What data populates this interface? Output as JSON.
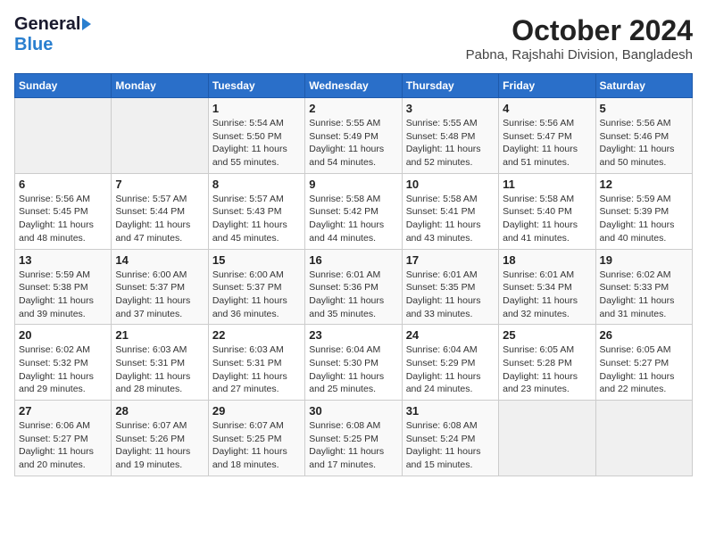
{
  "header": {
    "logo": {
      "general": "General",
      "blue": "Blue"
    },
    "title": "October 2024",
    "location": "Pabna, Rajshahi Division, Bangladesh"
  },
  "calendar": {
    "days_of_week": [
      "Sunday",
      "Monday",
      "Tuesday",
      "Wednesday",
      "Thursday",
      "Friday",
      "Saturday"
    ],
    "weeks": [
      [
        {
          "day": "",
          "info": ""
        },
        {
          "day": "",
          "info": ""
        },
        {
          "day": "1",
          "info": "Sunrise: 5:54 AM\nSunset: 5:50 PM\nDaylight: 11 hours and 55 minutes."
        },
        {
          "day": "2",
          "info": "Sunrise: 5:55 AM\nSunset: 5:49 PM\nDaylight: 11 hours and 54 minutes."
        },
        {
          "day": "3",
          "info": "Sunrise: 5:55 AM\nSunset: 5:48 PM\nDaylight: 11 hours and 52 minutes."
        },
        {
          "day": "4",
          "info": "Sunrise: 5:56 AM\nSunset: 5:47 PM\nDaylight: 11 hours and 51 minutes."
        },
        {
          "day": "5",
          "info": "Sunrise: 5:56 AM\nSunset: 5:46 PM\nDaylight: 11 hours and 50 minutes."
        }
      ],
      [
        {
          "day": "6",
          "info": "Sunrise: 5:56 AM\nSunset: 5:45 PM\nDaylight: 11 hours and 48 minutes."
        },
        {
          "day": "7",
          "info": "Sunrise: 5:57 AM\nSunset: 5:44 PM\nDaylight: 11 hours and 47 minutes."
        },
        {
          "day": "8",
          "info": "Sunrise: 5:57 AM\nSunset: 5:43 PM\nDaylight: 11 hours and 45 minutes."
        },
        {
          "day": "9",
          "info": "Sunrise: 5:58 AM\nSunset: 5:42 PM\nDaylight: 11 hours and 44 minutes."
        },
        {
          "day": "10",
          "info": "Sunrise: 5:58 AM\nSunset: 5:41 PM\nDaylight: 11 hours and 43 minutes."
        },
        {
          "day": "11",
          "info": "Sunrise: 5:58 AM\nSunset: 5:40 PM\nDaylight: 11 hours and 41 minutes."
        },
        {
          "day": "12",
          "info": "Sunrise: 5:59 AM\nSunset: 5:39 PM\nDaylight: 11 hours and 40 minutes."
        }
      ],
      [
        {
          "day": "13",
          "info": "Sunrise: 5:59 AM\nSunset: 5:38 PM\nDaylight: 11 hours and 39 minutes."
        },
        {
          "day": "14",
          "info": "Sunrise: 6:00 AM\nSunset: 5:37 PM\nDaylight: 11 hours and 37 minutes."
        },
        {
          "day": "15",
          "info": "Sunrise: 6:00 AM\nSunset: 5:37 PM\nDaylight: 11 hours and 36 minutes."
        },
        {
          "day": "16",
          "info": "Sunrise: 6:01 AM\nSunset: 5:36 PM\nDaylight: 11 hours and 35 minutes."
        },
        {
          "day": "17",
          "info": "Sunrise: 6:01 AM\nSunset: 5:35 PM\nDaylight: 11 hours and 33 minutes."
        },
        {
          "day": "18",
          "info": "Sunrise: 6:01 AM\nSunset: 5:34 PM\nDaylight: 11 hours and 32 minutes."
        },
        {
          "day": "19",
          "info": "Sunrise: 6:02 AM\nSunset: 5:33 PM\nDaylight: 11 hours and 31 minutes."
        }
      ],
      [
        {
          "day": "20",
          "info": "Sunrise: 6:02 AM\nSunset: 5:32 PM\nDaylight: 11 hours and 29 minutes."
        },
        {
          "day": "21",
          "info": "Sunrise: 6:03 AM\nSunset: 5:31 PM\nDaylight: 11 hours and 28 minutes."
        },
        {
          "day": "22",
          "info": "Sunrise: 6:03 AM\nSunset: 5:31 PM\nDaylight: 11 hours and 27 minutes."
        },
        {
          "day": "23",
          "info": "Sunrise: 6:04 AM\nSunset: 5:30 PM\nDaylight: 11 hours and 25 minutes."
        },
        {
          "day": "24",
          "info": "Sunrise: 6:04 AM\nSunset: 5:29 PM\nDaylight: 11 hours and 24 minutes."
        },
        {
          "day": "25",
          "info": "Sunrise: 6:05 AM\nSunset: 5:28 PM\nDaylight: 11 hours and 23 minutes."
        },
        {
          "day": "26",
          "info": "Sunrise: 6:05 AM\nSunset: 5:27 PM\nDaylight: 11 hours and 22 minutes."
        }
      ],
      [
        {
          "day": "27",
          "info": "Sunrise: 6:06 AM\nSunset: 5:27 PM\nDaylight: 11 hours and 20 minutes."
        },
        {
          "day": "28",
          "info": "Sunrise: 6:07 AM\nSunset: 5:26 PM\nDaylight: 11 hours and 19 minutes."
        },
        {
          "day": "29",
          "info": "Sunrise: 6:07 AM\nSunset: 5:25 PM\nDaylight: 11 hours and 18 minutes."
        },
        {
          "day": "30",
          "info": "Sunrise: 6:08 AM\nSunset: 5:25 PM\nDaylight: 11 hours and 17 minutes."
        },
        {
          "day": "31",
          "info": "Sunrise: 6:08 AM\nSunset: 5:24 PM\nDaylight: 11 hours and 15 minutes."
        },
        {
          "day": "",
          "info": ""
        },
        {
          "day": "",
          "info": ""
        }
      ]
    ]
  }
}
